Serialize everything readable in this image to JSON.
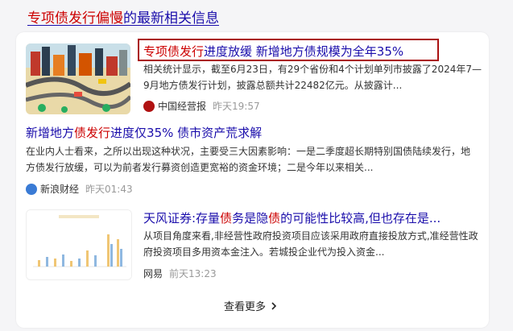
{
  "header": {
    "title_highlight": "专项债发行偏慢",
    "title_rest": "的最新相关信息"
  },
  "results": [
    {
      "title_highlight": "专项债发行",
      "title_rest": "进度放缓 新增地方债规模为全年35%",
      "snippet": "相关统计显示，截至6月23日，有29个省份和4个计划单列市披露了2024年7—9月地方债发行计划，披露总额共计22482亿元。从披露计...",
      "source": "中国经营报",
      "time": "昨天19:57",
      "logo_color": "#b01212"
    },
    {
      "title_pre": "新增地方",
      "title_highlight": "债发行",
      "title_rest": "进度仅35% 债市资产荒求解",
      "snippet": "在业内人士看来，之所以出现这种状况，主要受三大因素影响：一是二季度超长期特别国债陆续发行，地方债发行放缓，可以为前者发行募资创造更宽裕的资金环境；二是今年以来相关...",
      "source": "新浪财经",
      "time": "昨天01:43",
      "logo_color": "#3a7bd5"
    },
    {
      "title_pre": "天风证券:存量",
      "title_highlight": "债",
      "title_mid": "务是隐",
      "title_highlight2": "债",
      "title_rest": "的可能性比较高,但也存在是...",
      "snippet": "从项目角度来看,非经营性政府投资项目应该采用政府直接投放方式,准经营性政府投资项目多用资本金注入。若城投企业代为投入资金...",
      "source": "网易",
      "time": "前天13:23"
    }
  ],
  "footer": {
    "more_label": "查看更多"
  },
  "colors": {
    "link": "#1a0dab",
    "highlight": "#cc0000",
    "box": "#aa1111"
  }
}
